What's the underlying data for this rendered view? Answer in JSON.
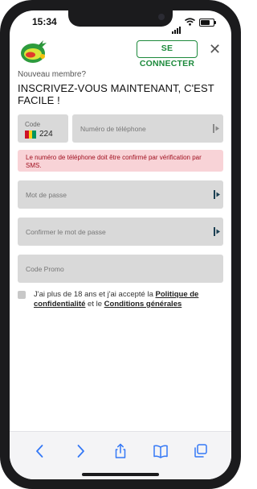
{
  "status_bar": {
    "time": "15:34"
  },
  "header": {
    "logo_icon": "lottery-logo-icon",
    "connect_label": "SE CONNECTER",
    "close_glyph": "✕"
  },
  "form": {
    "member_label": "Nouveau membre?",
    "title": "INSCRIVEZ-VOUS MAINTENANT, C'EST FACILE !",
    "code_label": "Code",
    "code_value": "224",
    "phone_placeholder": "Numéro de téléphone",
    "alert_text": "Le numéro de téléphone doit être confirmé par vérification par SMS.",
    "password_placeholder": "Mot de passe",
    "confirm_password_placeholder": "Confirmer le mot de passe",
    "promo_placeholder": "Code Promo",
    "terms_before": "J'ai plus de 18 ans et j'ai accepté la ",
    "terms_link1": "Politique de confidentialité",
    "terms_middle": " et le ",
    "terms_link2": "Conditions générales"
  },
  "colors": {
    "accent": "#1d8a3c",
    "alert_bg": "#f8d3d7",
    "alert_text": "#a01020",
    "field_bg": "#d9d9d9",
    "safari_icon": "#3478f6"
  },
  "safari_toolbar": {
    "icons": [
      "back-icon",
      "forward-icon",
      "share-icon",
      "bookmarks-icon",
      "tabs-icon"
    ]
  }
}
